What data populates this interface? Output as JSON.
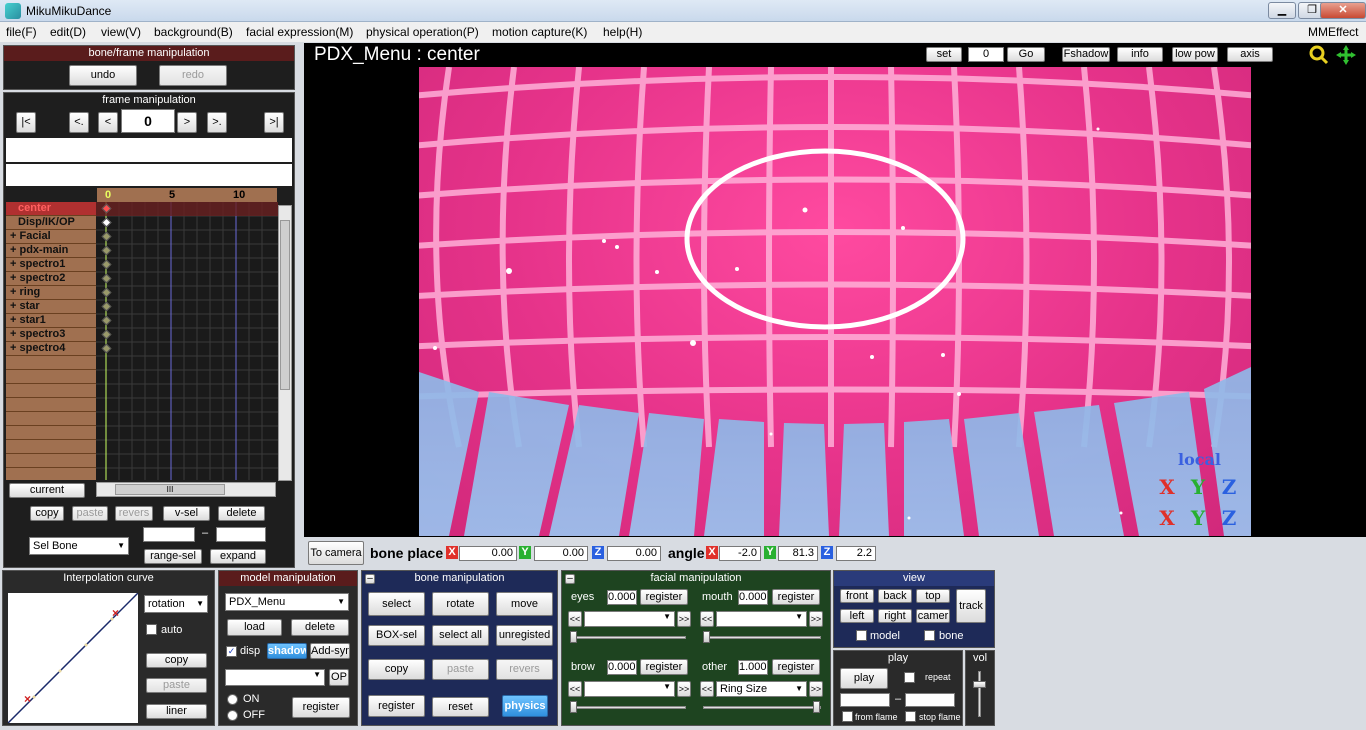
{
  "window": {
    "title": "MikuMikuDance",
    "min": "▁",
    "max": "❐",
    "close": "✕"
  },
  "menu": [
    "file(F)",
    "edit(D)",
    "view(V)",
    "background(B)",
    "facial expression(M)",
    "physical operation(P)",
    "motion capture(K)",
    "help(H)"
  ],
  "menu_right": "MMEffect",
  "bone_frame": {
    "header": "bone/frame manipulation",
    "undo": "undo",
    "redo": "redo"
  },
  "frame_manip": {
    "header": "frame manipulation",
    "frame": "0",
    "btn_first": "|<",
    "btn_prevkey": "<.",
    "btn_prev": "<",
    "btn_next": ">",
    "btn_nextkey": ">.",
    "btn_last": ">|"
  },
  "timeline": {
    "ticks": [
      "0",
      "5",
      "10"
    ],
    "rows": [
      "center",
      "Disp/IK/OP",
      "+ Facial",
      "+ pdx-main",
      "+ spectro1",
      "+ spectro2",
      "+ ring",
      "+ star",
      "+ star1",
      "+ spectro3",
      "+ spectro4"
    ],
    "current_btn": "current",
    "scroll_mid": "III",
    "copy": "copy",
    "paste": "paste",
    "revers": "revers",
    "vsel": "v-sel",
    "delete": "delete",
    "sel_bone": "Sel Bone",
    "range_sel": "range-sel",
    "dash": "–",
    "expand": "expand"
  },
  "viewport": {
    "title": "PDX_Menu : center",
    "set": "set",
    "set_value": "0",
    "go": "Go",
    "fshadow": "Fshadow",
    "info": "info",
    "lowpow": "low pow",
    "axis": "axis",
    "local": "local",
    "axis_x": "X",
    "axis_y": "Y",
    "axis_z": "Z",
    "colors": {
      "x": "#e0302a",
      "y": "#28b030",
      "z": "#2a60e0"
    }
  },
  "bone_place": {
    "to_camera": "To camera",
    "label": "bone place",
    "x_label": "X",
    "y_label": "Y",
    "z_label": "Z",
    "x": "0.00",
    "y": "0.00",
    "z": "0.00",
    "angle_label": "angle",
    "ax": "-2.0",
    "ay": "81.3",
    "az": "2.2"
  },
  "interp": {
    "header": "Interpolation curve",
    "mode": "rotation",
    "auto": "auto",
    "copy": "copy",
    "paste": "paste",
    "liner": "liner"
  },
  "model": {
    "header": "model manipulation",
    "model": "PDX_Menu",
    "load": "load",
    "delete": "delete",
    "disp": "disp",
    "shadow": "shadow",
    "addsyn": "Add-syn",
    "op": "OP",
    "on": "ON",
    "off": "OFF",
    "register": "register"
  },
  "bone": {
    "header": "bone manipulation",
    "select": "select",
    "rotate": "rotate",
    "move": "move",
    "boxsel": "BOX-sel",
    "selectall": "select all",
    "unregisted": "unregisted",
    "copy": "copy",
    "paste": "paste",
    "revers": "revers",
    "register": "register",
    "reset": "reset",
    "physics": "physics",
    "collapse": "–"
  },
  "facial": {
    "header": "facial manipulation",
    "collapse": "–",
    "eyes": "eyes",
    "eyes_val": "0.000",
    "mouth": "mouth",
    "mouth_val": "0.000",
    "brow": "brow",
    "brow_val": "0.000",
    "other": "other",
    "other_val": "1.000",
    "other_sel": "Ring Size",
    "register": "register",
    "ll": "<<",
    "gg": ">>"
  },
  "view": {
    "header": "view",
    "front": "front",
    "back": "back",
    "top": "top",
    "left": "left",
    "right": "right",
    "camera": "camer",
    "track": "track",
    "model": "model",
    "bone": "bone"
  },
  "play": {
    "header": "play",
    "play": "play",
    "repeat": "repeat",
    "dash": "–",
    "from": "from flame",
    "stop": "stop flame"
  },
  "vol": {
    "header": "vol"
  }
}
